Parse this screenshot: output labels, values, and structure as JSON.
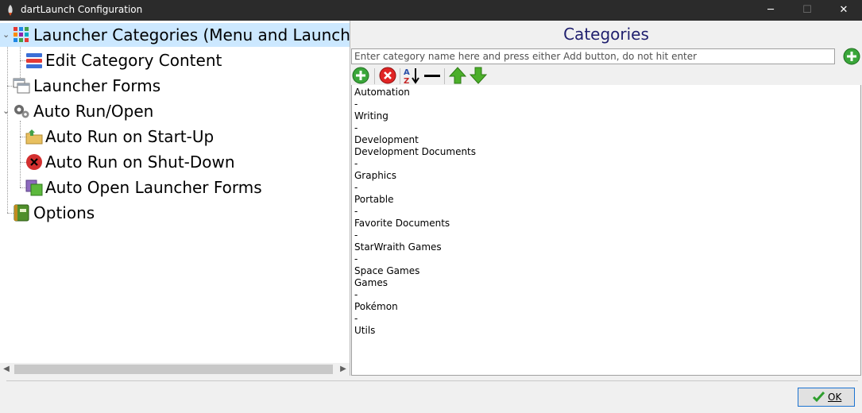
{
  "window": {
    "title": "dartLaunch Configuration",
    "minimize_glyph": "─",
    "maximize_glyph": "☐",
    "close_glyph": "✕"
  },
  "tree": {
    "items": [
      {
        "label": "Launcher Categories (Menu and Launcher)",
        "icon": "grid-icon",
        "selected": true
      },
      {
        "label": "Edit Category Content",
        "icon": "stacked-bars-icon"
      },
      {
        "label": "Launcher Forms",
        "icon": "windows-icon"
      },
      {
        "label": "Auto Run/Open",
        "icon": "gears-icon"
      },
      {
        "label": "Auto Run on Start-Up",
        "icon": "folder-up-icon"
      },
      {
        "label": "Auto Run on Shut-Down",
        "icon": "red-x-circle-icon"
      },
      {
        "label": "Auto Open Launcher Forms",
        "icon": "green-forms-icon"
      },
      {
        "label": "Options",
        "icon": "options-book-icon"
      }
    ]
  },
  "categories_panel": {
    "title": "Categories",
    "input_placeholder": "Enter category name here and press either Add button, do not hit enter",
    "items": [
      "Automation",
      "-",
      "Writing",
      "-",
      "Development",
      "Development Documents",
      "-",
      "Graphics",
      "-",
      "Portable",
      "-",
      "Favorite Documents",
      "-",
      "StarWraith Games",
      "-",
      "Space Games",
      "Games",
      "-",
      "Pokémon",
      "-",
      "Utils"
    ]
  },
  "footer": {
    "ok_label": "OK"
  },
  "colors": {
    "title_bar": "#2b2b2b",
    "selection": "#cce8ff",
    "categories_title": "#1f1f6e",
    "add_green": "#3aa63a",
    "delete_red": "#e02424"
  }
}
